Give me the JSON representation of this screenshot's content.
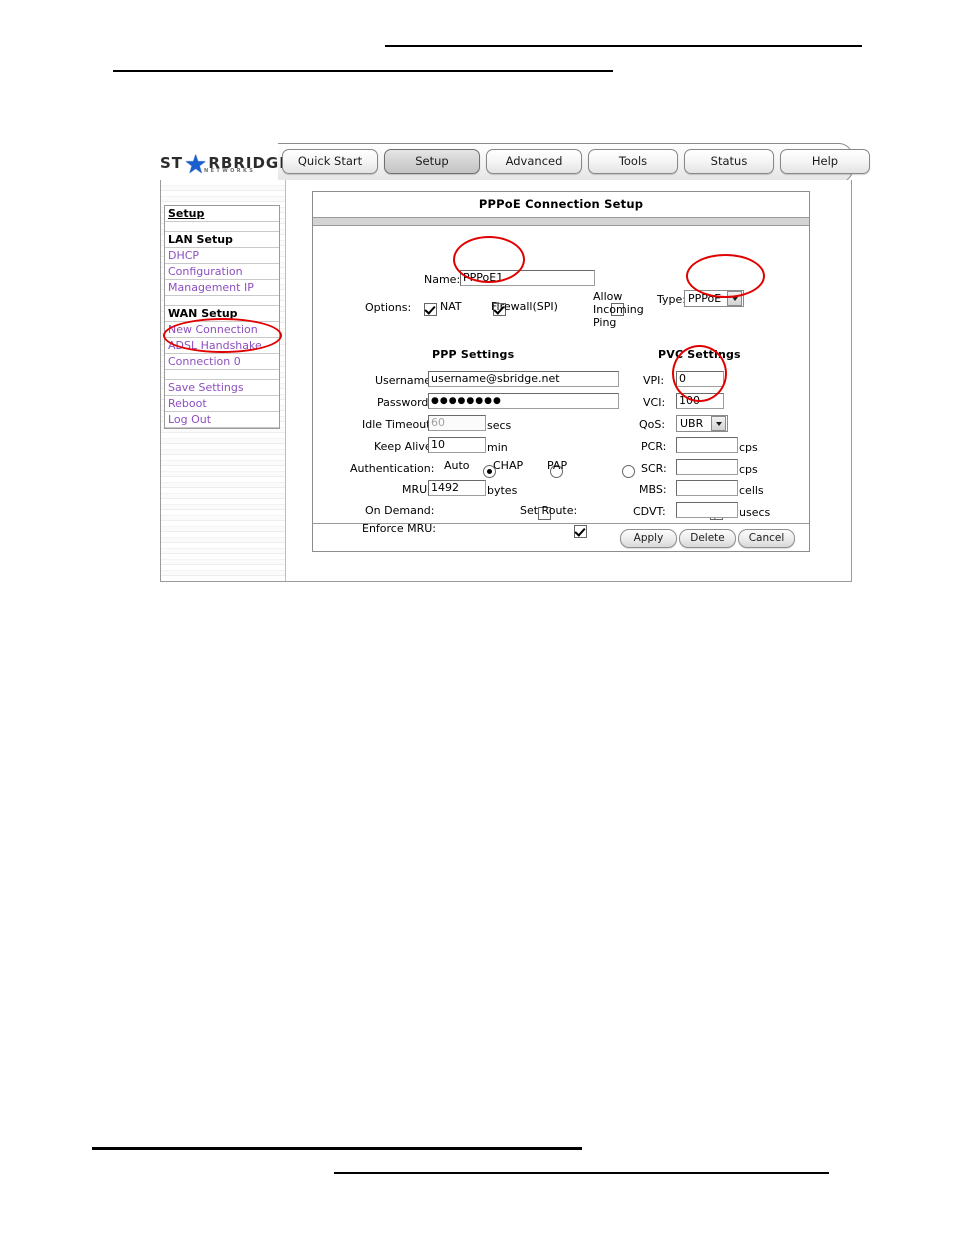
{
  "page": {
    "header_rules": 2,
    "footer_rules": 2
  },
  "browser_ui": {
    "logo": {
      "text_left": "ST",
      "star": "★",
      "text_right": "RBRIDGE",
      "subtitle": "NETWORKS"
    },
    "tabs": [
      {
        "label": "Quick Start",
        "selected": false
      },
      {
        "label": "Setup",
        "selected": true
      },
      {
        "label": "Advanced",
        "selected": false
      },
      {
        "label": "Tools",
        "selected": false
      },
      {
        "label": "Status",
        "selected": false
      },
      {
        "label": "Help",
        "selected": false
      }
    ]
  },
  "sidebar": {
    "items": [
      {
        "label": "Setup",
        "type": "head-under"
      },
      {
        "label": "",
        "type": "spacer"
      },
      {
        "label": "LAN Setup",
        "type": "head"
      },
      {
        "label": "DHCP",
        "type": "link"
      },
      {
        "label": "Configuration",
        "type": "link"
      },
      {
        "label": "Management IP",
        "type": "link"
      },
      {
        "label": "",
        "type": "spacer"
      },
      {
        "label": "WAN Setup",
        "type": "head"
      },
      {
        "label": "New Connection",
        "type": "link"
      },
      {
        "label": "ADSL Handshake",
        "type": "link"
      },
      {
        "label": "Connection 0",
        "type": "link"
      },
      {
        "label": "",
        "type": "spacer"
      },
      {
        "label": "Save Settings",
        "type": "link"
      },
      {
        "label": "Reboot",
        "type": "link"
      },
      {
        "label": "Log Out",
        "type": "link"
      }
    ]
  },
  "form": {
    "title": "PPPoE Connection Setup",
    "name": {
      "label": "Name:",
      "value": "PPPoE1"
    },
    "options": {
      "label": "Options:",
      "nat": {
        "label": "NAT",
        "checked": true
      },
      "firewall": {
        "label": "Firewall(SPI)",
        "checked": true
      },
      "allow_ping": {
        "label_line1": "Allow",
        "label_line2": "Incoming",
        "label_line3": "Ping",
        "checked": false
      }
    },
    "type": {
      "label": "Type:",
      "value": "PPPoE"
    },
    "ppp": {
      "section_title": "PPP Settings",
      "username": {
        "label": "Username:",
        "value": "username@sbridge.net"
      },
      "password": {
        "label": "Password:",
        "value": "●●●●●●●●"
      },
      "idle_timeout": {
        "label": "Idle Timeout:",
        "value": "60",
        "unit": "secs",
        "disabled": true
      },
      "keep_alive": {
        "label": "Keep Alive:",
        "value": "10",
        "unit": "min"
      },
      "authentication": {
        "label": "Authentication:",
        "options": [
          {
            "label": "Auto",
            "selected": true
          },
          {
            "label": "CHAP",
            "selected": false
          },
          {
            "label": "PAP",
            "selected": false
          }
        ]
      },
      "mru": {
        "label": "MRU:",
        "value": "1492",
        "unit": "bytes"
      },
      "on_demand": {
        "label": "On Demand:",
        "checked": false
      },
      "set_route": {
        "label": "Set Route:",
        "checked": true
      },
      "enforce_mru": {
        "label": "Enforce MRU:",
        "checked": true
      }
    },
    "pvc": {
      "section_title": "PVC Settings",
      "vpi": {
        "label": "VPI:",
        "value": "0"
      },
      "vci": {
        "label": "VCI:",
        "value": "100"
      },
      "qos": {
        "label": "QoS:",
        "value": "UBR"
      },
      "pcr": {
        "label": "PCR:",
        "value": "",
        "unit": "cps"
      },
      "scr": {
        "label": "SCR:",
        "value": "",
        "unit": "cps"
      },
      "mbs": {
        "label": "MBS:",
        "value": "",
        "unit": "cells"
      },
      "cdvt": {
        "label": "CDVT:",
        "value": "",
        "unit": "usecs"
      }
    },
    "buttons": [
      {
        "label": "Apply"
      },
      {
        "label": "Delete"
      },
      {
        "label": "Cancel"
      }
    ]
  },
  "annotations": {
    "color": "#e00000",
    "ellipses": [
      {
        "target": "name-field"
      },
      {
        "target": "type-dropdown"
      },
      {
        "target": "sidebar-new-connection"
      },
      {
        "target": "vpi-vci-fields"
      }
    ]
  }
}
